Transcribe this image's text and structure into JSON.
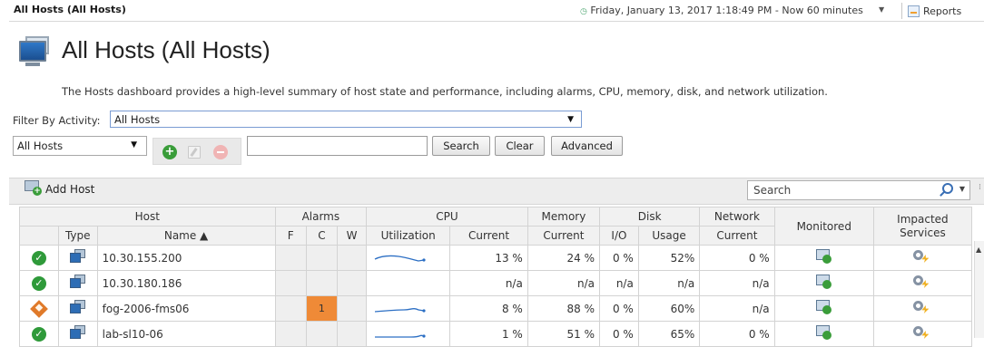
{
  "header": {
    "page_label": "All Hosts (All Hosts)",
    "time_range": "Friday, January 13, 2017 1:18:49 PM - Now 60 minutes",
    "reports_label": "Reports"
  },
  "title": {
    "text": "All Hosts (All Hosts)",
    "description": "The Hosts dashboard provides a high-level summary of host state and performance, including alarms, CPU, memory, disk, and network utilization."
  },
  "filter": {
    "label": "Filter By Activity:",
    "value": "All Hosts"
  },
  "scope": {
    "value": "All Hosts"
  },
  "search": {
    "value": "",
    "search_button": "Search",
    "clear_button": "Clear",
    "advanced_button": "Advanced"
  },
  "grid_toolbar": {
    "add_host_label": "Add Host",
    "search_placeholder": "Search"
  },
  "table": {
    "group_headers": {
      "host": "Host",
      "alarms": "Alarms",
      "cpu": "CPU",
      "memory": "Memory",
      "disk": "Disk",
      "network": "Network",
      "monitored": "Monitored",
      "impacted_services": "Impacted Services"
    },
    "sub_headers": {
      "type": "Type",
      "name": "Name ▲",
      "alarms_f": "F",
      "alarms_c": "C",
      "alarms_w": "W",
      "cpu_utilization": "Utilization",
      "cpu_current": "Current",
      "memory_current": "Current",
      "disk_io": "I/O",
      "disk_usage": "Usage",
      "network_current": "Current"
    },
    "rows": [
      {
        "status": "ok",
        "name": "10.30.155.200",
        "alarm_f": "",
        "alarm_c": "",
        "alarm_w": "",
        "cpu_spark": true,
        "cpu": "13 %",
        "memory": "24 %",
        "disk_io": "0 %",
        "disk_usage": "52%",
        "network": "0 %"
      },
      {
        "status": "ok",
        "name": "10.30.180.186",
        "alarm_f": "",
        "alarm_c": "",
        "alarm_w": "",
        "cpu_spark": false,
        "cpu": "n/a",
        "memory": "n/a",
        "disk_io": "n/a",
        "disk_usage": "n/a",
        "network": "n/a"
      },
      {
        "status": "warning",
        "name": "fog-2006-fms06",
        "alarm_f": "",
        "alarm_c": "1",
        "alarm_w": "",
        "cpu_spark": true,
        "cpu": "8 %",
        "memory": "88 %",
        "disk_io": "0 %",
        "disk_usage": "60%",
        "network": "n/a"
      },
      {
        "status": "ok",
        "name": "lab-sl10-06",
        "alarm_f": "",
        "alarm_c": "",
        "alarm_w": "",
        "cpu_spark": true,
        "cpu": "1 %",
        "memory": "51 %",
        "disk_io": "0 %",
        "disk_usage": "65%",
        "network": "0 %"
      }
    ]
  },
  "colors": {
    "status_ok": "#2f9a3a",
    "status_warning": "#e07a2a",
    "critical_alarm": "#ef8a37",
    "spark_line": "#2c6fc4"
  },
  "icons": {
    "title": "hosts-monitor-icon",
    "type": "host-type-icon",
    "monitored": "monitored-icon",
    "impacted": "impacted-services-icon"
  }
}
